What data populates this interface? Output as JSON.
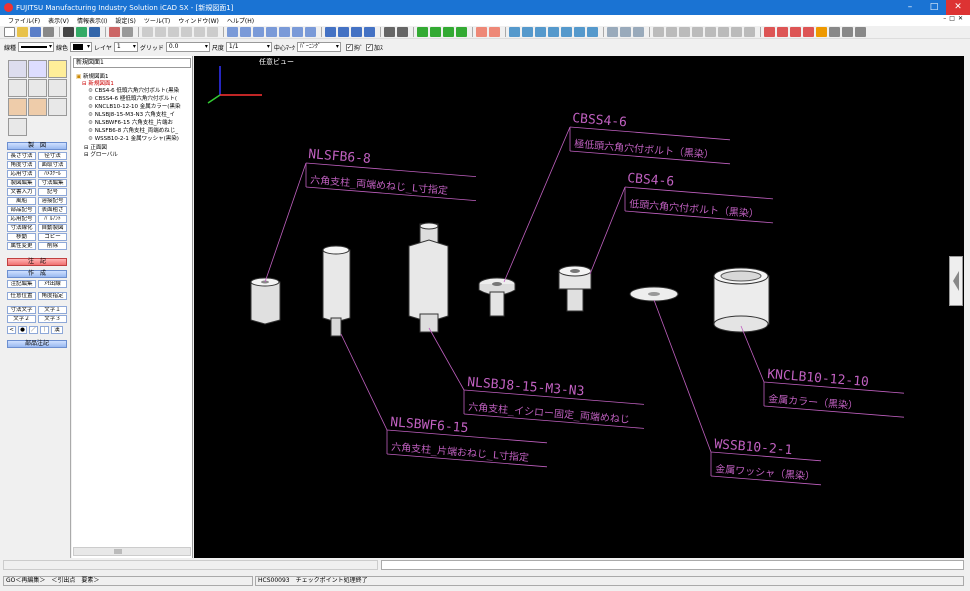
{
  "window": {
    "title": "FUJITSU Manufacturing Industry Solution iCAD SX - [新規図面1]"
  },
  "menu": [
    "ファイル(F)",
    "表示(V)",
    "情報表示(I)",
    "設定(S)",
    "ツール(T)",
    "ウィンドウ(W)",
    "ヘルプ(H)"
  ],
  "toolbar3": {
    "linetype_label": "線種",
    "color_label": "線色",
    "layer_label": "レイヤ",
    "layer_value": "1",
    "grid_label": "グリッド",
    "grid_value": "0.0",
    "scale_label": "尺度",
    "scale_value": "1/1",
    "center_label": "中心ﾏｰｸ",
    "center_value": "ﾊﾟｰﾆﾝｸﾞ",
    "chk1": "拘ﾞ",
    "chk2": "加ｽ"
  },
  "leftpanel": {
    "section_drawing": "製　図",
    "buttons_a": [
      [
        "長さ寸法",
        "径寸法"
      ],
      [
        "角度寸法",
        "面取寸法"
      ],
      [
        "応用寸法",
        "ﾊﾒｽｹｰﾙ"
      ],
      [
        "製図編集",
        "寸法編集"
      ],
      [
        "文書入力",
        "記号"
      ],
      [
        "風船",
        "溶接記号"
      ],
      [
        "部品記号",
        "表面粗さ"
      ],
      [
        "応用記号",
        "ﾊﾞﾙﾉﾝﾄ"
      ],
      [
        "寸法線化",
        "自動製図"
      ],
      [
        "移動",
        "コピー"
      ],
      [
        "属性変更",
        "削除"
      ]
    ],
    "section_note": "注　記",
    "section_create": "作　成",
    "buttons_b": [
      [
        "注記編集",
        "ﾒﾓ出線"
      ]
    ],
    "buttons_c": [
      [
        "任意位置",
        "角度指定"
      ]
    ],
    "buttons_d": [
      [
        "寸法文字",
        "文字１"
      ],
      [
        "文字２",
        "文字３"
      ]
    ],
    "bottom_btn": "部品注記"
  },
  "tree": {
    "selector": "新規図面1",
    "root": "新規図面1",
    "sub": "新規図面1",
    "items": [
      "CBS4-6 低頭六角穴付ボルト(黒染",
      "CBSS4-6 極低頭六角穴付ボルト(",
      "KNCLB10-12-10 金属カラー(黒染",
      "NLSBJ8-15-M3-N3 六角支柱_イ",
      "NLSBWF6-15 六角支柱_片端お",
      "NLSFB6-8 六角支柱_両端めねじ_",
      "WSSB10-2-1 金属ワッシャ(黒染)"
    ],
    "views": [
      "正面図",
      "グローバル"
    ]
  },
  "canvas": {
    "view_label": "任意ビュー",
    "callouts": [
      {
        "code": "NLSFB6-8",
        "desc": "六角支柱_両端めねじ_L寸指定"
      },
      {
        "code": "CBSS4-6",
        "desc": "極低頭六角穴付ボルト（黒染）"
      },
      {
        "code": "CBS4-6",
        "desc": "低頭六角穴付ボルト（黒染）"
      },
      {
        "code": "NLSBJ8-15-M3-N3",
        "desc": "六角支柱_イシロー固定_両端めねじ"
      },
      {
        "code": "NLSBWF6-15",
        "desc": "六角支柱_片端おねじ_L寸指定"
      },
      {
        "code": "KNCLB10-12-10",
        "desc": "金属カラー（黒染）"
      },
      {
        "code": "WSSB10-2-1",
        "desc": "金属ワッシャ（黒染）"
      }
    ]
  },
  "status": {
    "left": "GO＜再編集＞　＜引出点　要素＞",
    "msg": "HCS00093　チェックポイント処理終了"
  },
  "colors": {
    "title_bg": "#1a73d3",
    "canvas_bg": "#000000",
    "leader": "#c060c0"
  }
}
